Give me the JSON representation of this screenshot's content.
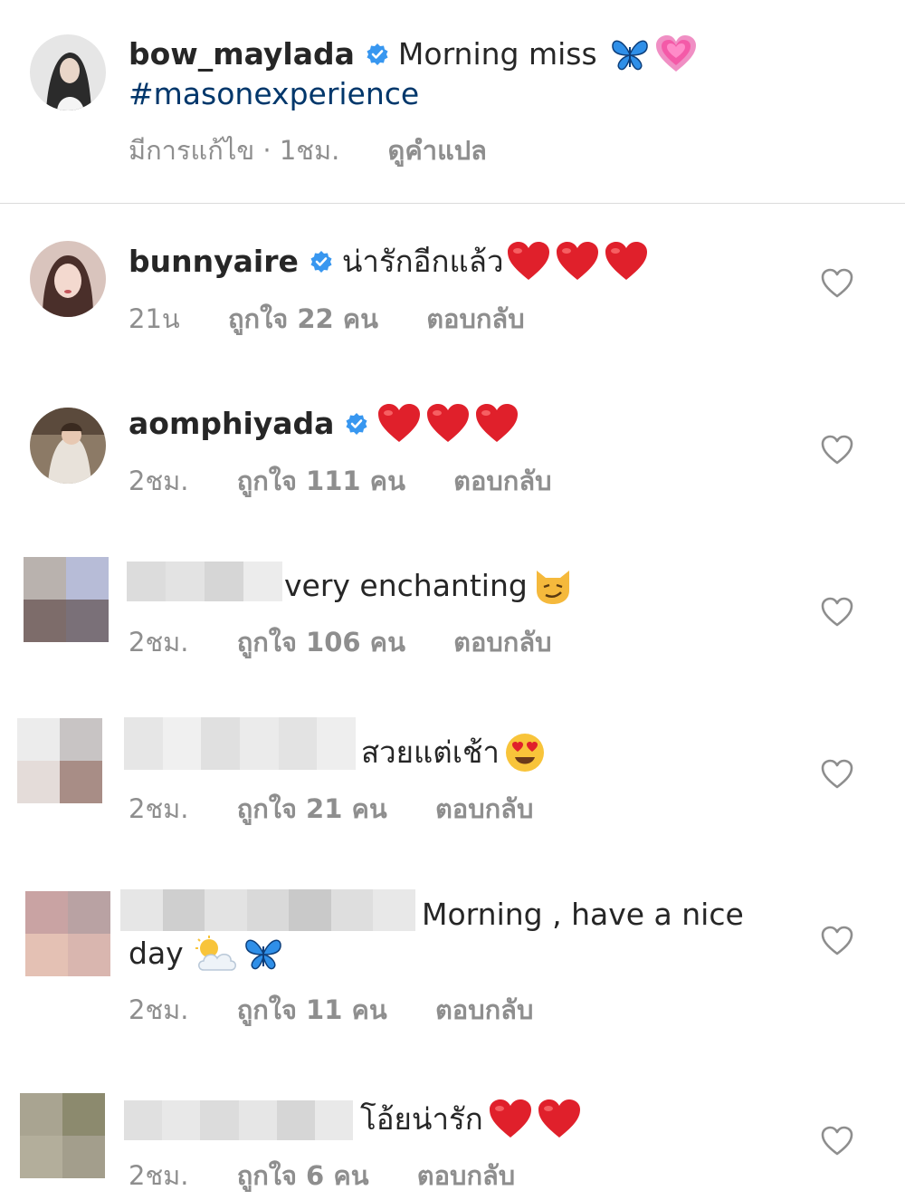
{
  "caption": {
    "username": "bow_maylada",
    "text": "Morning miss",
    "emojis": [
      "blue-butterfly",
      "growing-heart"
    ],
    "hashtag": "#masonexperience",
    "edited": "มีการแก้ไข · 1ชม.",
    "translate": "ดูคำแปล"
  },
  "comments": [
    {
      "username": "bunnyaire",
      "verified": true,
      "text": "น่ารักอีกแล้ว",
      "emojis": [
        "red-heart",
        "red-heart",
        "red-heart"
      ],
      "time": "21น",
      "likes": "ถูกใจ 22 คน",
      "reply": "ตอบกลับ"
    },
    {
      "username": "aomphiyada",
      "verified": true,
      "text": "",
      "emojis": [
        "red-heart",
        "red-heart",
        "red-heart"
      ],
      "time": "2ชม.",
      "likes": "ถูกใจ 111 คน",
      "reply": "ตอบกลับ"
    },
    {
      "username": "",
      "verified": false,
      "text": "very enchanting",
      "emojis": [
        "smirking-cat"
      ],
      "time": "2ชม.",
      "likes": "ถูกใจ 106 คน",
      "reply": "ตอบกลับ"
    },
    {
      "username": "",
      "verified": false,
      "text": "สวยแต่เช้า",
      "emojis": [
        "heart-eyes"
      ],
      "time": "2ชม.",
      "likes": "ถูกใจ 21 คน",
      "reply": "ตอบกลับ"
    },
    {
      "username": "",
      "verified": false,
      "text": "Morning , have a nice",
      "text_line2": "day",
      "emojis": [
        "sun-behind-cloud",
        "blue-butterfly"
      ],
      "time": "2ชม.",
      "likes": "ถูกใจ 11 คน",
      "reply": "ตอบกลับ"
    },
    {
      "username": "",
      "verified": false,
      "text": "โอ้ยน่ารัก",
      "emojis": [
        "red-heart",
        "red-heart"
      ],
      "time": "2ชม.",
      "likes": "ถูกใจ 6 คน",
      "reply": "ตอบกลับ"
    }
  ],
  "colors": {
    "verified_blue": "#3897f0",
    "meta_gray": "#8e8e8e",
    "heart_red": "#e0202b",
    "hashtag": "#00376b"
  }
}
